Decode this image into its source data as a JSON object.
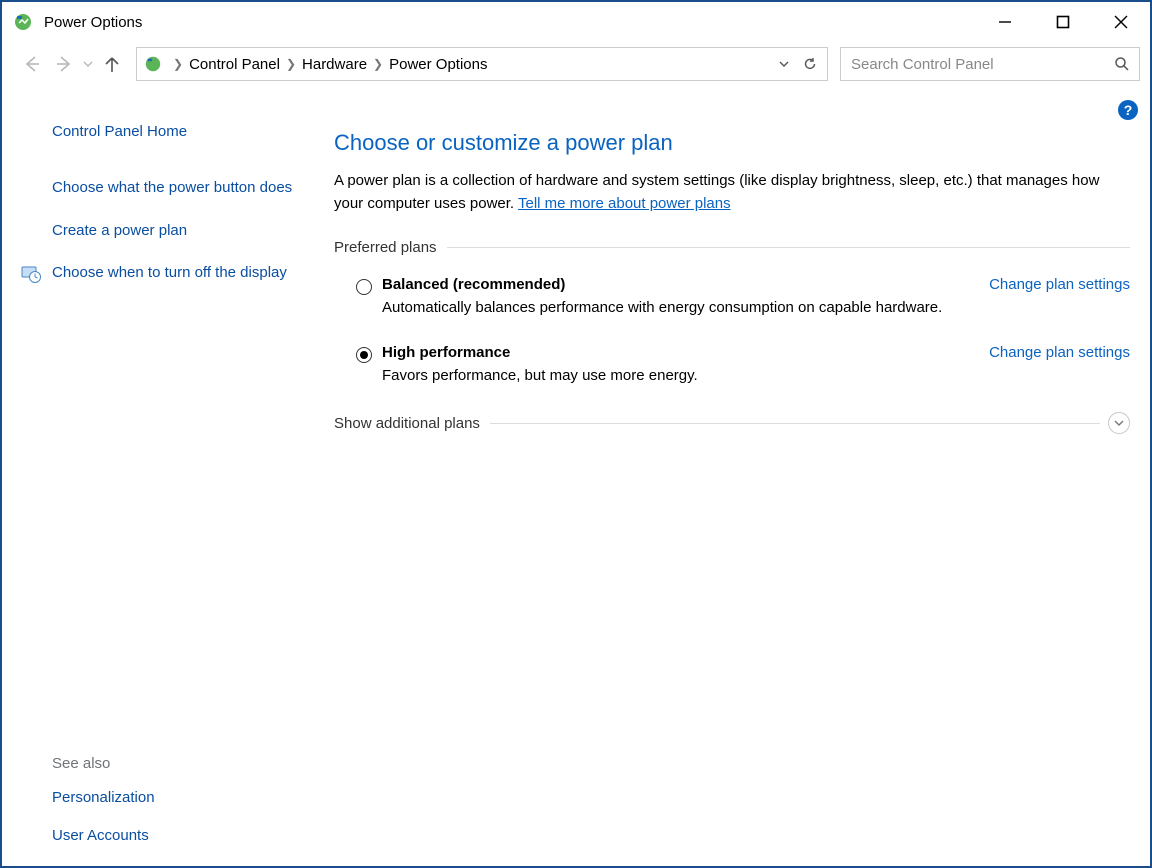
{
  "window": {
    "title": "Power Options"
  },
  "breadcrumb": {
    "items": [
      "Control Panel",
      "Hardware",
      "Power Options"
    ]
  },
  "search": {
    "placeholder": "Search Control Panel"
  },
  "help_badge": "?",
  "sidebar": {
    "home": "Control Panel Home",
    "links": [
      "Choose what the power button does",
      "Create a power plan",
      "Choose when to turn off the display"
    ],
    "see_also_label": "See also",
    "see_also": [
      "Personalization",
      "User Accounts"
    ]
  },
  "main": {
    "heading": "Choose or customize a power plan",
    "description_prefix": "A power plan is a collection of hardware and system settings (like display brightness, sleep, etc.) that manages how your computer uses power. ",
    "description_link": "Tell me more about power plans",
    "preferred_label": "Preferred plans",
    "additional_label": "Show additional plans",
    "change_link": "Change plan settings",
    "plans": [
      {
        "name": "Balanced (recommended)",
        "desc": "Automatically balances performance with energy consumption on capable hardware.",
        "selected": false
      },
      {
        "name": "High performance",
        "desc": "Favors performance, but may use more energy.",
        "selected": true
      }
    ]
  }
}
